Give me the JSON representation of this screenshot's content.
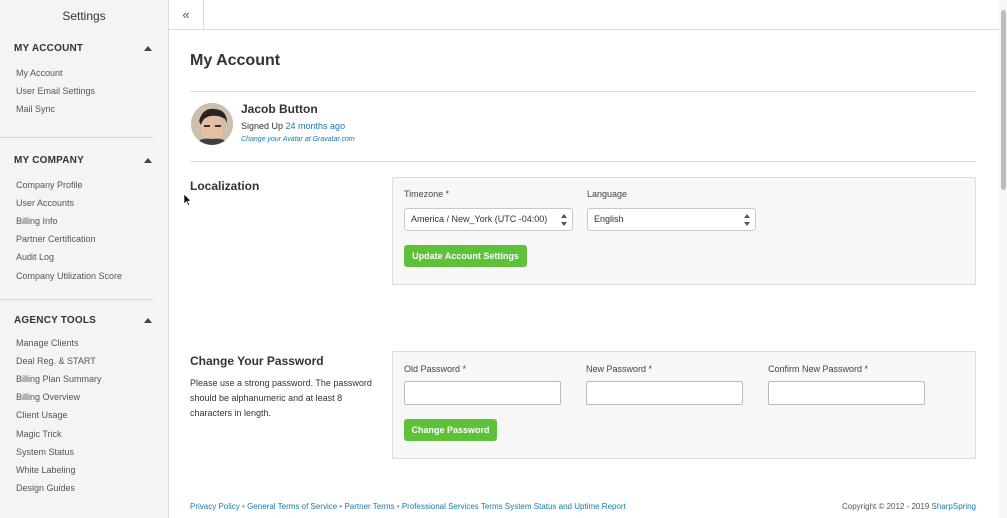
{
  "sidebar": {
    "title": "Settings",
    "sections": [
      {
        "heading": "MY ACCOUNT",
        "items": [
          "My Account",
          "User Email Settings",
          "Mail Sync"
        ]
      },
      {
        "heading": "MY COMPANY",
        "items": [
          "Company Profile",
          "User Accounts",
          "Billing Info",
          "Partner Certification",
          "Audit Log",
          "Company Utilization Score"
        ]
      },
      {
        "heading": "AGENCY TOOLS",
        "items": [
          "Manage Clients",
          "Deal Reg. & START",
          "Billing Plan Summary",
          "Billing Overview",
          "Client Usage",
          "Magic Trick",
          "System Status",
          "White Labeling",
          "Design Guides"
        ]
      }
    ]
  },
  "topbar": {
    "collapse_icon": "«"
  },
  "page": {
    "title": "My Account"
  },
  "profile": {
    "name": "Jacob Button",
    "signed_up_prefix": "Signed Up ",
    "signed_up_ago": "24 months ago",
    "gravatar_link": "Change your Avatar at Gravatar.com"
  },
  "localization": {
    "title": "Localization",
    "timezone_label": "Timezone *",
    "timezone_value": "America / New_York (UTC -04:00)",
    "language_label": "Language",
    "language_value": "English",
    "update_button": "Update Account Settings"
  },
  "password": {
    "title": "Change Your Password",
    "description": "Please use a strong password. The password should be alphanumeric and at least 8 characters in length.",
    "old_label": "Old Password *",
    "new_label": "New Password *",
    "confirm_label": "Confirm New Password *",
    "change_button": "Change Password"
  },
  "footer": {
    "links": [
      "Privacy Policy",
      "General Terms of Service",
      "Partner Terms",
      "Professional Services Terms",
      "System Status and Uptime Report"
    ],
    "separator": "•",
    "copyright": "Copyright © 2012 - 2019 ",
    "brand": "SharpSpring"
  },
  "colors": {
    "accent_green": "#5fc13a",
    "link_blue": "#1a7ab0"
  }
}
